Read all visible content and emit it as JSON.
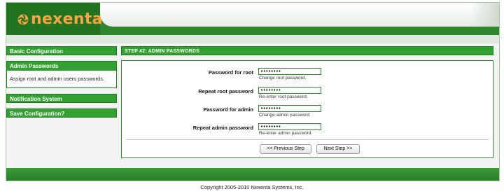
{
  "brand": {
    "name": "nexenta",
    "logo_color": "#f4a640"
  },
  "sidebar": {
    "items": [
      {
        "label": "Basic Configuration"
      },
      {
        "label": "Admin Passwords",
        "description": "Assign root and admin users passwords."
      },
      {
        "label": "Notification System"
      },
      {
        "label": "Save Configuration?"
      }
    ]
  },
  "main": {
    "step_title": "STEP #2: ADMIN PASSWORDS",
    "fields": [
      {
        "label": "Password for root",
        "value": "••••••••",
        "hint": "Change root password."
      },
      {
        "label": "Repeat root password",
        "value": "••••••••",
        "hint": "Re-enter root password."
      },
      {
        "label": "Password for admin",
        "value": "••••••••",
        "hint": "Change admin password."
      },
      {
        "label": "Repeat admin password",
        "value": "••••••••",
        "hint": "Re-enter admin password."
      }
    ],
    "prev_button": "<< Previous Step",
    "next_button": "Next Step >>"
  },
  "footer": {
    "copyright": "Copyright 2005-2010 Nexenta Systems, Inc."
  },
  "colors": {
    "accent_green": "#33a032",
    "dark_green": "#1d7a1d"
  }
}
